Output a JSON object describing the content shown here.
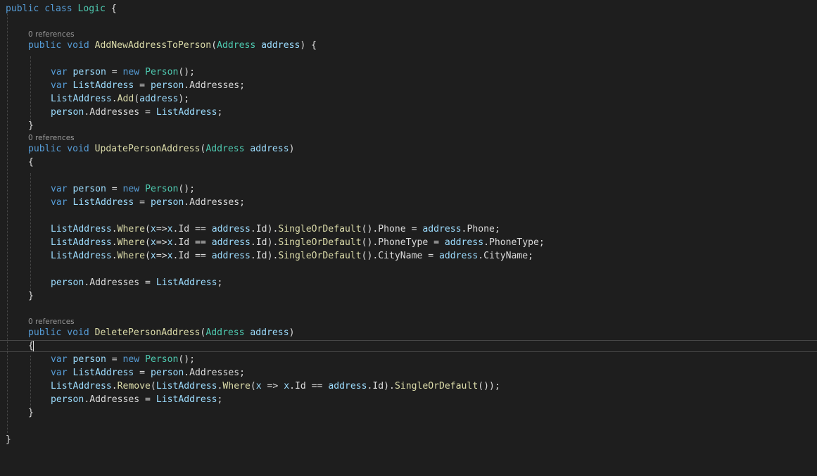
{
  "code": {
    "colors": {
      "background": "#1e1e1e",
      "keyword": "#569cd6",
      "type": "#4ec9b0",
      "method": "#dcdcaa",
      "variable": "#9cdcfe",
      "plain": "#dcdcdc",
      "codelens": "#999999"
    },
    "codelens": {
      "add_method": "0 references",
      "update_method": "0 references",
      "delete_method": "0 references"
    },
    "tokens": {
      "kw_public": "public",
      "kw_class": "class",
      "kw_void": "void",
      "kw_var": "var",
      "kw_new": "new",
      "class_logic": "Logic",
      "type_address": "Address",
      "type_person": "Person",
      "m_add_new": "AddNewAddressToPerson",
      "m_update": "UpdatePersonAddress",
      "m_delete": "DeletePersonAddress",
      "m_add": "Add",
      "m_where": "Where",
      "m_single": "SingleOrDefault",
      "m_remove": "Remove",
      "v_address": "address",
      "v_person": "person",
      "v_list": "ListAddress",
      "v_x": "x",
      "p_addresses": "Addresses",
      "p_id": "Id",
      "p_phone": "Phone",
      "p_phonetype": "PhoneType",
      "p_cityname": "CityName",
      "op_lambda": "=>",
      "op_eq": "==",
      "op_assign": "="
    }
  }
}
